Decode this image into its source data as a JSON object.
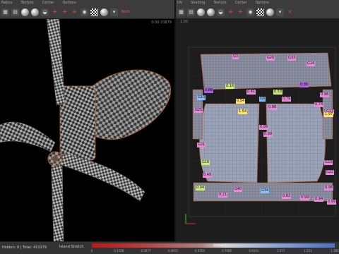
{
  "left_panel": {
    "menu": [
      "Nakus",
      "Texture",
      "Center",
      "Options"
    ],
    "axes_label": "Both",
    "corner_info": "0.00 23879"
  },
  "right_panel": {
    "menu": [
      "UV",
      "Shading",
      "Texture",
      "Center",
      "Options"
    ],
    "coord": "1.00"
  },
  "uv_labels": [
    {
      "t": "G3",
      "c": "#e58ad8"
    },
    {
      "t": "G20",
      "c": "#e58ad8"
    },
    {
      "t": "G33",
      "c": "#e58ad8"
    },
    {
      "t": "G14",
      "c": "#e58ad8"
    },
    {
      "t": "0.88",
      "c": "#b25ee0"
    },
    {
      "t": "0.86",
      "c": "#b25ee0"
    },
    {
      "t": "0.16",
      "c": "#cdeb7a"
    },
    {
      "t": "G10",
      "c": "#88c0ff"
    },
    {
      "t": "0.54",
      "c": "#ffe36b"
    },
    {
      "t": "0.41",
      "c": "#e58ad8"
    },
    {
      "t": "0.53",
      "c": "#cdeb7a"
    },
    {
      "t": "0.79",
      "c": "#e58ad8"
    },
    {
      "t": "G9",
      "c": "#88c0ff"
    },
    {
      "t": "0.98",
      "c": "#e58ad8"
    },
    {
      "t": "1.54",
      "c": "#ffe36b"
    },
    {
      "t": "0.96",
      "c": "#e58ad8"
    },
    {
      "t": "G25",
      "c": "#e58ad8"
    },
    {
      "t": "G13",
      "c": "#e58ad8"
    },
    {
      "t": "0.74",
      "c": "#e58ad8"
    },
    {
      "t": "1.97",
      "c": "#ffe36b"
    },
    {
      "t": "G21",
      "c": "#e58ad8"
    },
    {
      "t": "0.99",
      "c": "#e58ad8"
    },
    {
      "t": "0.99",
      "c": "#e58ad8"
    },
    {
      "t": "G16",
      "c": "#cdeb7a"
    },
    {
      "t": "G23",
      "c": "#e58ad8"
    },
    {
      "t": "0.49",
      "c": "#e58ad8"
    },
    {
      "t": "G22",
      "c": "#e58ad8"
    },
    {
      "t": "0.04",
      "c": "#cdeb7a"
    },
    {
      "t": "0.96",
      "c": "#e58ad8"
    },
    {
      "t": "0.21",
      "c": "#e58ad8"
    },
    {
      "t": "G40",
      "c": "#e58ad8"
    },
    {
      "t": "G34",
      "c": "#88c0ff"
    },
    {
      "t": "0.82",
      "c": "#e58ad8"
    },
    {
      "t": "0.99",
      "c": "#e58ad8"
    },
    {
      "t": "0.94",
      "c": "#e58ad8"
    },
    {
      "t": "0.99",
      "c": "#e58ad8"
    }
  ],
  "status": {
    "text": "Hidden: 0 | Total: 453379",
    "stretch_mode": "Island Stretch",
    "stretch_title": "Stretch",
    "ticks": [
      "0",
      "0.1538",
      "0.3077",
      "0.4615",
      "0.6154",
      "0.7692",
      "0.9231",
      "1.077",
      "1.231",
      "1.385"
    ]
  },
  "uv_bottom": [
    "Ta",
    "U",
    "V"
  ]
}
